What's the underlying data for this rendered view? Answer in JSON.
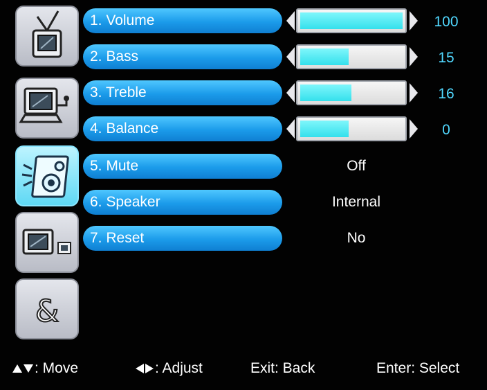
{
  "colors": {
    "pill": "#1b9bea",
    "active_category": "#5fd8f4",
    "fill": "#34e0ec",
    "value_text": "#51d8ff"
  },
  "categories": [
    {
      "icon": "tv-antenna-icon",
      "active": false
    },
    {
      "icon": "pc-input-icon",
      "active": false
    },
    {
      "icon": "speaker-audio-icon",
      "active": true
    },
    {
      "icon": "picture-in-picture-icon",
      "active": false
    },
    {
      "icon": "ampersand-icon",
      "active": false
    }
  ],
  "menu": {
    "items": [
      {
        "label": "1. Volume",
        "value": "100",
        "level": 1.0
      },
      {
        "label": "2. Bass",
        "value": "15",
        "level": 0.47
      },
      {
        "label": "3. Treble",
        "value": "16",
        "level": 0.5
      },
      {
        "label": "4. Balance",
        "value": "0",
        "level": 0.47
      },
      {
        "label": "5. Mute",
        "value": "Off"
      },
      {
        "label": "6. Speaker",
        "value": "Internal"
      },
      {
        "label": "7. Reset",
        "value": "No"
      }
    ]
  },
  "footer": {
    "move": ": Move",
    "adjust": ": Adjust",
    "exit": "Exit: Back",
    "enter": "Enter: Select"
  }
}
